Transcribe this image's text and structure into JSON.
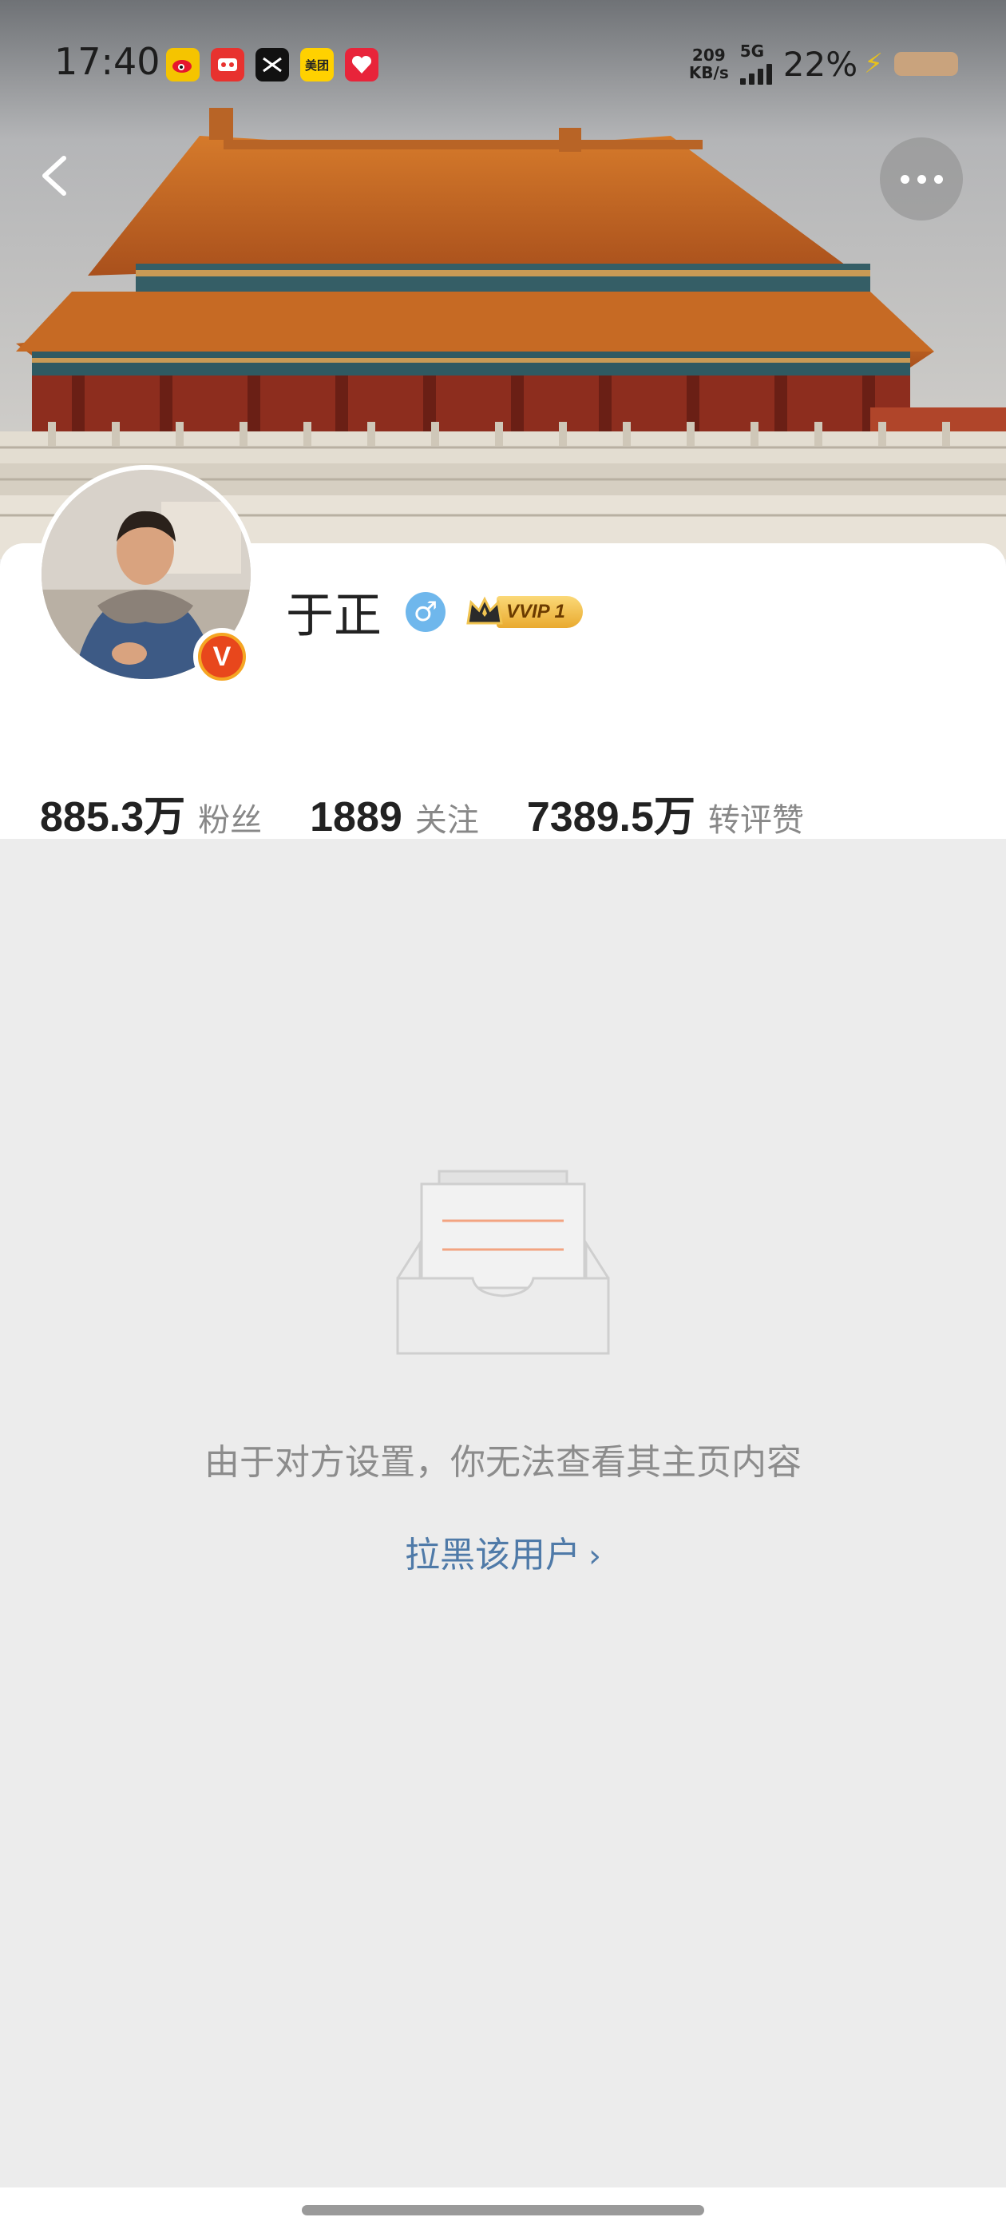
{
  "status_bar": {
    "time": "17:40",
    "apps": [
      {
        "icon": "weibo-app-icon",
        "label": "",
        "color": "#f5c400"
      },
      {
        "icon": "game-app-icon",
        "label": "",
        "color": "#e8322f"
      },
      {
        "icon": "capcut-app-icon",
        "label": "",
        "color": "#111111"
      },
      {
        "icon": "meituan-app-icon",
        "label": "美团",
        "color": "#ffd100"
      },
      {
        "icon": "health-app-icon",
        "label": "",
        "color": "#e8243a"
      }
    ],
    "network_speed_value": "209",
    "network_speed_unit": "KB/s",
    "network_type": "5G",
    "battery_percent": "22%"
  },
  "nav": {
    "back_icon": "chevron-left-icon",
    "more_icon": "more-dots-icon"
  },
  "profile": {
    "name": "于正",
    "gender_symbol": "♂",
    "vip_label": "VVIP 1",
    "verified_badge": "V",
    "stats": [
      {
        "value": "885.3万",
        "label": "粉丝"
      },
      {
        "value": "1889",
        "label": "关注"
      },
      {
        "value": "7389.5万",
        "label": "转评赞"
      }
    ]
  },
  "empty_state": {
    "icon": "empty-inbox-icon",
    "message": "由于对方设置，你无法查看其主页内容",
    "action_label": "拉黑该用户",
    "action_chevron": "›"
  },
  "colors": {
    "link": "#4f7aa8",
    "gender_badge": "#6fb7ec",
    "verified_outer": "#f5a623",
    "verified_inner": "#e8471c",
    "page_background": "#ececec"
  }
}
